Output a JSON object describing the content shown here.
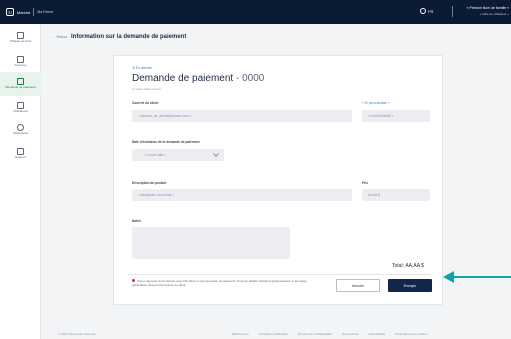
{
  "header": {
    "brand_logo": "ℳ",
    "brand_name": "Marché",
    "brand_sub": "Ma Ferme",
    "lang": "FR",
    "user_name": "« Prénom Nom de famille »",
    "user_sub": "« Rôle de utilisateur »"
  },
  "sidebar": {
    "items": [
      {
        "label": "Tableau de bord",
        "icon": "dashboard-icon"
      },
      {
        "label": "Factures",
        "icon": "invoice-icon"
      },
      {
        "label": "Demande de paiement",
        "icon": "payment-request-icon"
      },
      {
        "label": "Utilisateurs",
        "icon": "users-icon"
      },
      {
        "label": "Paramètres",
        "icon": "gear-icon"
      },
      {
        "label": "Rapport",
        "icon": "report-icon"
      }
    ]
  },
  "page": {
    "back_label": "← Retour",
    "title": "Information sur la demande de paiement"
  },
  "form": {
    "status": "⟲ En attente",
    "title": "Demande de paiement",
    "number": " - 0000",
    "subtitle": "À mode statut d'envoi",
    "email_label": "Courriel du client",
    "email_value": "« adresse_du_client@domaine.com »",
    "id_label": "« ID personnalisé »",
    "id_value": "« a1b2c3d4e5f6 »",
    "due_label": "Date d'échéance de la demande de paiement",
    "due_value": "« 1 mois date »",
    "desc_label": "Description du produit",
    "desc_value": "« description du produit »",
    "price_label": "Prix",
    "price_value": "AA,AA $",
    "notes_label": "Notes",
    "notes_value": "",
    "total_label": "Total:",
    "total_value": "AA,AA $",
    "notice": "Vous n'agit pas d'une facture avec l'ID client et une demande de paiement. Tous les détails d'achat supplémentaires et les taxes applicables doivent être fournis au client.",
    "cancel_label": "Annuler",
    "submit_label": "Envoyer"
  },
  "footer": {
    "copyright": "© 2024 Tous droits réservés",
    "links": [
      "Marché.com",
      "Conditions d'utilisation",
      "Énoncé de confidentialité",
      "Nous joindre",
      "Accessibilité",
      "Paramètres des cookies"
    ]
  },
  "colors": {
    "topbar": "#0c1b34",
    "accent_arrow": "#12a3a8",
    "submit": "#11264a",
    "active_nav": "#e7f3ec"
  }
}
